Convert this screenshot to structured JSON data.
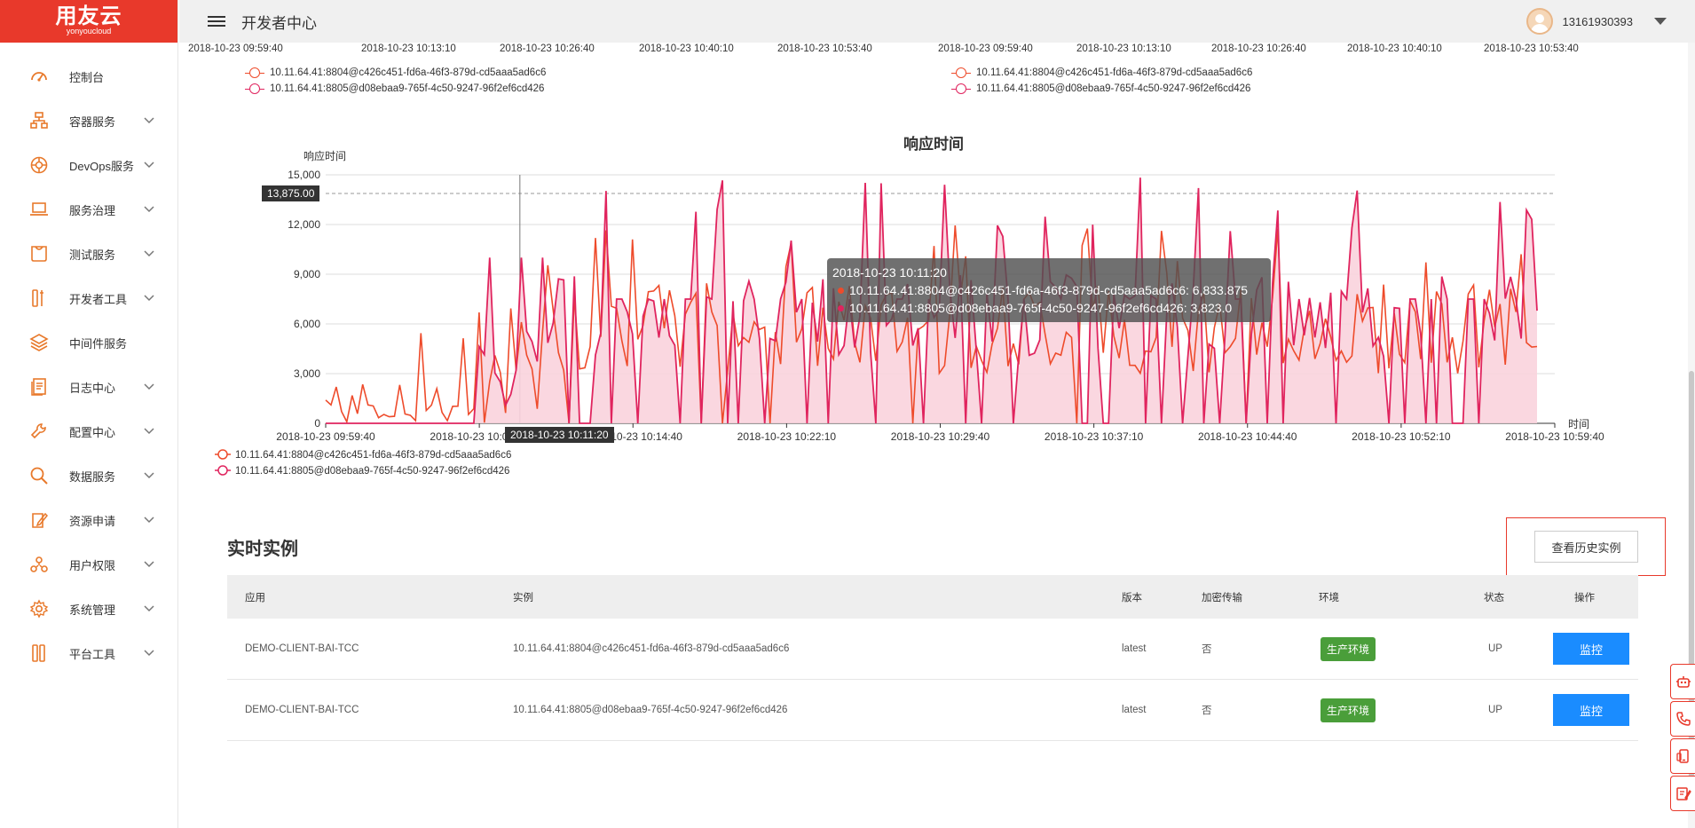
{
  "logo": {
    "main": "用友云",
    "sub": "yonyoucloud"
  },
  "header": {
    "title": "开发者中心",
    "username": "13161930393"
  },
  "sidebar": {
    "items": [
      {
        "label": "控制台",
        "icon": "dashboard-icon",
        "expand": false
      },
      {
        "label": "容器服务",
        "icon": "container-icon",
        "expand": true
      },
      {
        "label": "DevOps服务",
        "icon": "devops-icon",
        "expand": true
      },
      {
        "label": "服务治理",
        "icon": "laptop-icon",
        "expand": true
      },
      {
        "label": "测试服务",
        "icon": "test-bag-icon",
        "expand": true
      },
      {
        "label": "开发者工具",
        "icon": "tools-icon",
        "expand": true
      },
      {
        "label": "中间件服务",
        "icon": "layers-icon",
        "expand": false
      },
      {
        "label": "日志中心",
        "icon": "log-icon",
        "expand": true
      },
      {
        "label": "配置中心",
        "icon": "wrench-icon",
        "expand": true
      },
      {
        "label": "数据服务",
        "icon": "search-data-icon",
        "expand": true
      },
      {
        "label": "资源申请",
        "icon": "resource-apply-icon",
        "expand": true
      },
      {
        "label": "用户权限",
        "icon": "user-permission-icon",
        "expand": true
      },
      {
        "label": "系统管理",
        "icon": "gear-icon",
        "expand": true
      },
      {
        "label": "平台工具",
        "icon": "platform-tools-icon",
        "expand": true
      }
    ]
  },
  "top_panels": {
    "left_ticks": [
      "2018-10-23 09:59:40",
      "2018-10-23 10:13:10",
      "2018-10-23 10:26:40",
      "2018-10-23 10:40:10",
      "2018-10-23 10:53:40"
    ],
    "right_ticks": [
      "2018-10-23 09:59:40",
      "2018-10-23 10:13:10",
      "2018-10-23 10:26:40",
      "2018-10-23 10:40:10",
      "2018-10-23 10:53:40"
    ],
    "legend": [
      "10.11.64.41:8804@c426c451-fd6a-46f3-879d-cd5aaa5ad6c6",
      "10.11.64.41:8805@d08ebaa9-765f-4c50-9247-96f2ef6cd426"
    ]
  },
  "chart_data": {
    "type": "line",
    "title": "响应时间",
    "ylabel": "响应时间",
    "xlabel": "时间",
    "ylim": [
      0,
      15000
    ],
    "yticks": [
      "0",
      "3,000",
      "6,000",
      "9,000",
      "12,000",
      "15,000"
    ],
    "xticks": [
      "2018-10-23 09:59:40",
      "2018-10-23 10:07:10",
      "2018-10-23 10:14:40",
      "2018-10-23 10:22:10",
      "2018-10-23 10:29:40",
      "2018-10-23 10:37:10",
      "2018-10-23 10:44:40",
      "2018-10-23 10:52:10",
      "2018-10-23 10:59:40"
    ],
    "crosshair_x_label": "2018-10-23 10:11:20",
    "crosshair_y_label": "13,875.00",
    "series": [
      {
        "name": "10.11.64.41:8804@c426c451-fd6a-46f3-879d-cd5aaa5ad6c6",
        "color": "#ee4b2b"
      },
      {
        "name": "10.11.64.41:8805@d08ebaa9-765f-4c50-9247-96f2ef6cd426",
        "color": "#e0245e"
      }
    ],
    "grid": true,
    "legend_position": "bottom-left"
  },
  "tooltip": {
    "time": "2018-10-23 10:11:20",
    "rows": [
      {
        "text": "10.11.64.41:8804@c426c451-fd6a-46f3-879d-cd5aaa5ad6c6: 6,833.875",
        "color": "#ee4b2b"
      },
      {
        "text": "10.11.64.41:8805@d08ebaa9-765f-4c50-9247-96f2ef6cd426: 3,823.0",
        "color": "#e0245e"
      }
    ]
  },
  "realtime": {
    "title": "实时实例",
    "history_button": "查看历史实例",
    "columns": {
      "app": "应用",
      "instance": "实例",
      "version": "版本",
      "encrypt": "加密传输",
      "env": "环境",
      "status": "状态",
      "action": "操作"
    },
    "rows": [
      {
        "app": "DEMO-CLIENT-BAI-TCC",
        "instance": "10.11.64.41:8804@c426c451-fd6a-46f3-879d-cd5aaa5ad6c6",
        "version": "latest",
        "encrypt": "否",
        "env": "生产环境",
        "status": "UP",
        "action": "监控"
      },
      {
        "app": "DEMO-CLIENT-BAI-TCC",
        "instance": "10.11.64.41:8805@d08ebaa9-765f-4c50-9247-96f2ef6cd426",
        "version": "latest",
        "encrypt": "否",
        "env": "生产环境",
        "status": "UP",
        "action": "监控"
      }
    ]
  },
  "colors": {
    "brand": "#e8392b",
    "primary": "#1a8cff",
    "env_badge": "#4a9e3a",
    "series1": "#ee4b2b",
    "series2": "#e0245e",
    "area_fill": "#f9d3dd"
  }
}
